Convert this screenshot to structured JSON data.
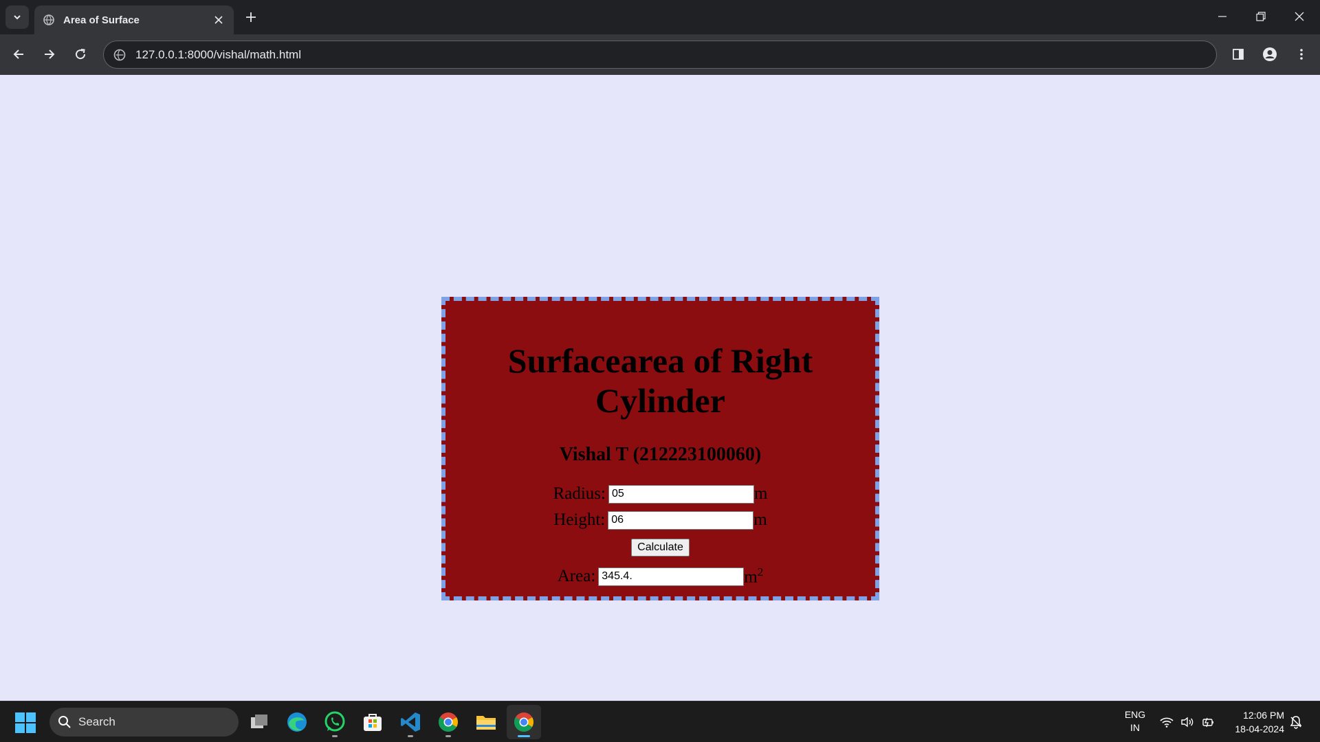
{
  "browser": {
    "tab_title": "Area of Surface",
    "url": "127.0.0.1:8000/vishal/math.html"
  },
  "page": {
    "heading": "Surfacearea of Right Cylinder",
    "subheading": "Vishal T (212223100060)",
    "radius_label": "Radius:",
    "radius_value": "05",
    "radius_unit": "m",
    "height_label": "Height:",
    "height_value": "06",
    "height_unit": "m",
    "calculate_label": "Calculate",
    "area_label": "Area:",
    "area_value": "345.4.",
    "area_unit": "m",
    "area_unit_exp": "2"
  },
  "taskbar": {
    "search_placeholder": "Search",
    "apps": [
      "task-view",
      "edge",
      "whatsapp",
      "store",
      "vscode",
      "chrome",
      "file-explorer",
      "chrome-active"
    ],
    "lang_line1": "ENG",
    "lang_line2": "IN",
    "time": "12:06 PM",
    "date": "18-04-2024"
  },
  "colors": {
    "page_bg": "#e6e6fa",
    "card_bg": "#8b0d10",
    "card_border": "#7fa2e6"
  }
}
